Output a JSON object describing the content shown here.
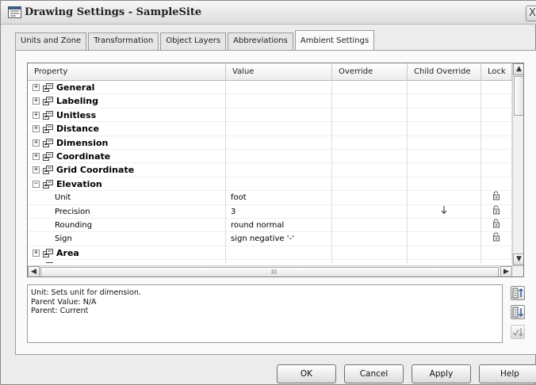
{
  "window": {
    "title": "Drawing Settings - SampleSite",
    "close_glyph": "X"
  },
  "tabs": [
    {
      "label": "Units and Zone",
      "active": false
    },
    {
      "label": "Transformation",
      "active": false
    },
    {
      "label": "Object Layers",
      "active": false
    },
    {
      "label": "Abbreviations",
      "active": false
    },
    {
      "label": "Ambient Settings",
      "active": true
    }
  ],
  "grid": {
    "columns": [
      "Property",
      "Value",
      "Override",
      "Child Override",
      "Lock"
    ],
    "rows": [
      {
        "type": "category",
        "expander": "+",
        "label": "General"
      },
      {
        "type": "category",
        "expander": "+",
        "label": "Labeling"
      },
      {
        "type": "category",
        "expander": "+",
        "label": "Unitless"
      },
      {
        "type": "category",
        "expander": "+",
        "label": "Distance"
      },
      {
        "type": "category",
        "expander": "+",
        "label": "Dimension"
      },
      {
        "type": "category",
        "expander": "+",
        "label": "Coordinate"
      },
      {
        "type": "category",
        "expander": "+",
        "label": "Grid Coordinate"
      },
      {
        "type": "category",
        "expander": "−",
        "label": "Elevation"
      },
      {
        "type": "property",
        "label": "Unit",
        "value": "foot",
        "child_override": false,
        "lock": true
      },
      {
        "type": "property",
        "label": "Precision",
        "value": "3",
        "child_override": true,
        "lock": true
      },
      {
        "type": "property",
        "label": "Rounding",
        "value": "round normal",
        "child_override": false,
        "lock": true
      },
      {
        "type": "property",
        "label": "Sign",
        "value": "sign negative '-'",
        "child_override": false,
        "lock": true
      },
      {
        "type": "category",
        "expander": "+",
        "label": "Area"
      },
      {
        "type": "category",
        "expander": "+",
        "label": "Volume"
      }
    ]
  },
  "scrollbars": {
    "up": "▲",
    "down": "▼",
    "left": "◀",
    "right": "▶",
    "grip": "III"
  },
  "description": {
    "line1": "Unit: Sets unit for dimension.",
    "line2": "Parent Value: N/A",
    "line3": "Parent: Current"
  },
  "footer": {
    "ok": "OK",
    "cancel": "Cancel",
    "apply": "Apply",
    "help": "Help"
  },
  "colors": {
    "accent": "#3a6db5",
    "grid_line": "#dcdcdc",
    "window_bg": "#ececec"
  }
}
